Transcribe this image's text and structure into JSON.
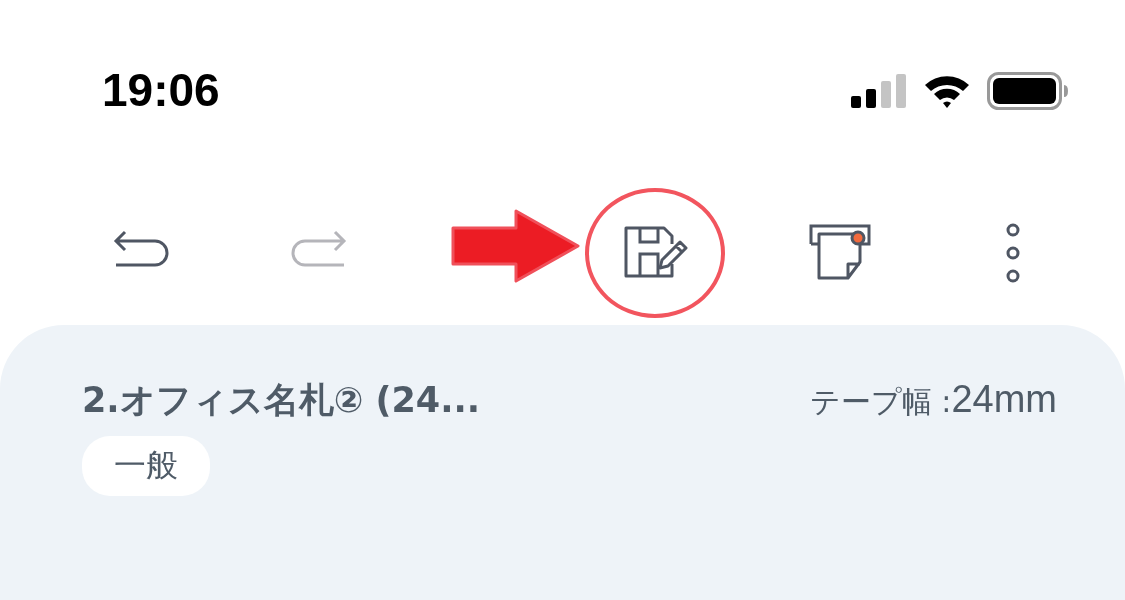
{
  "status_bar": {
    "time": "19:06"
  },
  "toolbar": [
    {
      "kind": "undo",
      "disabled": false,
      "annotated": false
    },
    {
      "kind": "redo",
      "disabled": true,
      "annotated": false
    },
    {
      "kind": "save",
      "disabled": false,
      "annotated": true
    },
    {
      "kind": "tape",
      "disabled": false,
      "annotated": false
    },
    {
      "kind": "more",
      "disabled": false,
      "annotated": false
    }
  ],
  "label": {
    "title": "2.オフィス名札② (24...",
    "tape_width_label": "テープ幅 :",
    "tape_width_value": "24mm",
    "tag": "一般"
  }
}
